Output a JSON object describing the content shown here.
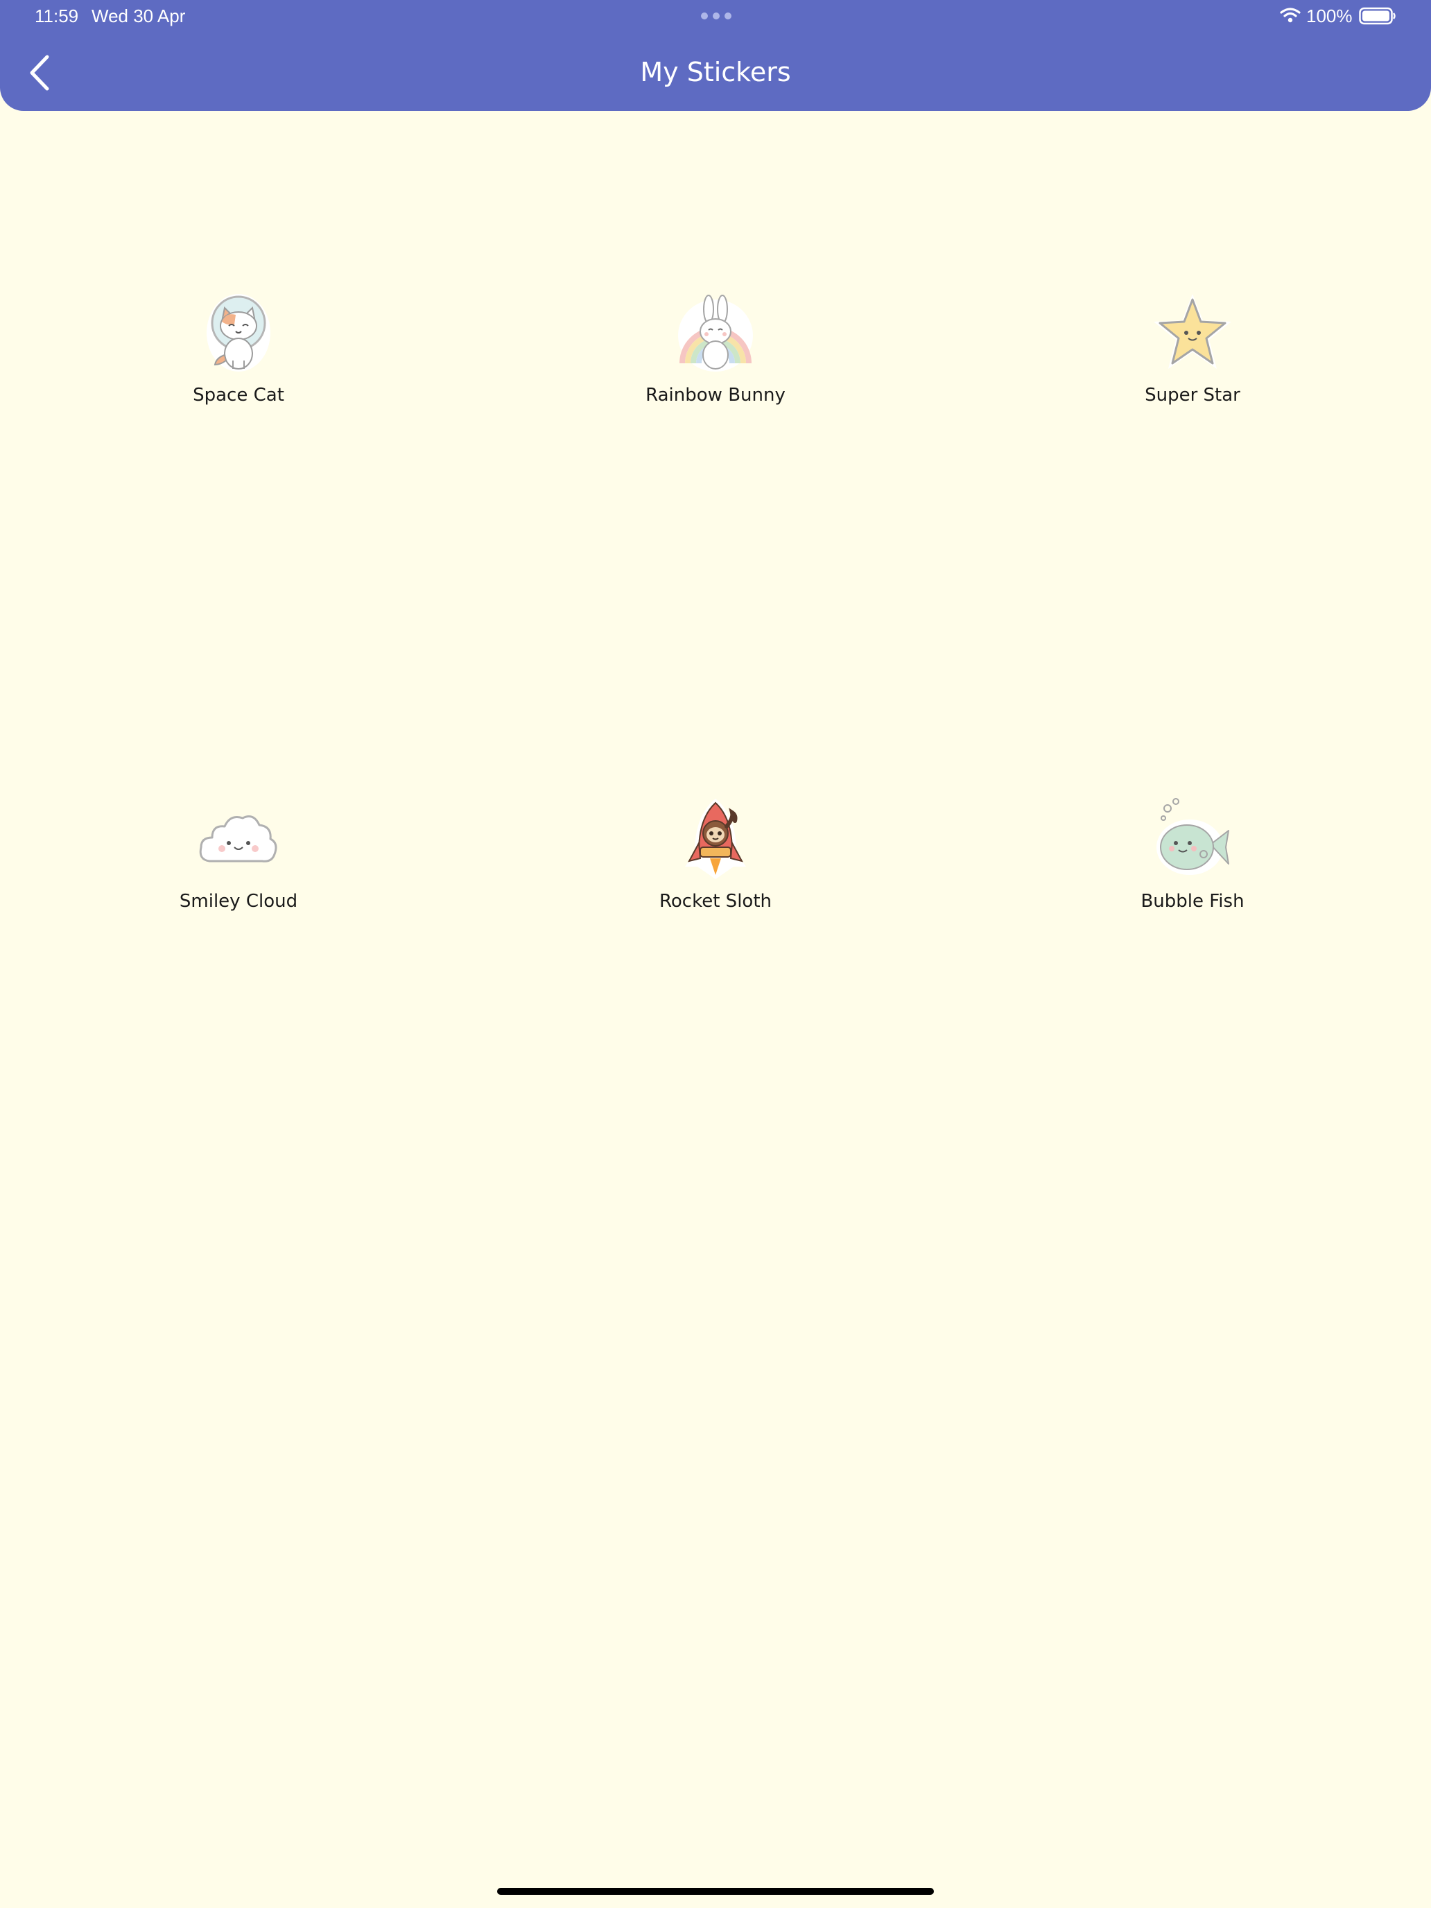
{
  "status_bar": {
    "time": "11:59",
    "date": "Wed 30 Apr",
    "battery": "100%"
  },
  "header": {
    "title": "My Stickers",
    "back_icon": "chevron-left-icon"
  },
  "stickers": [
    {
      "label": "Space Cat",
      "icon": "space-cat-sticker"
    },
    {
      "label": "Rainbow Bunny",
      "icon": "rainbow-bunny-sticker"
    },
    {
      "label": "Super Star",
      "icon": "super-star-sticker"
    },
    {
      "label": "Smiley Cloud",
      "icon": "smiley-cloud-sticker"
    },
    {
      "label": "Rocket Sloth",
      "icon": "rocket-sloth-sticker"
    },
    {
      "label": "Bubble Fish",
      "icon": "bubble-fish-sticker"
    }
  ],
  "colors": {
    "header_bg": "#5E6BC2",
    "page_bg": "#FFFDE9",
    "label_text": "#1A1A1A"
  }
}
